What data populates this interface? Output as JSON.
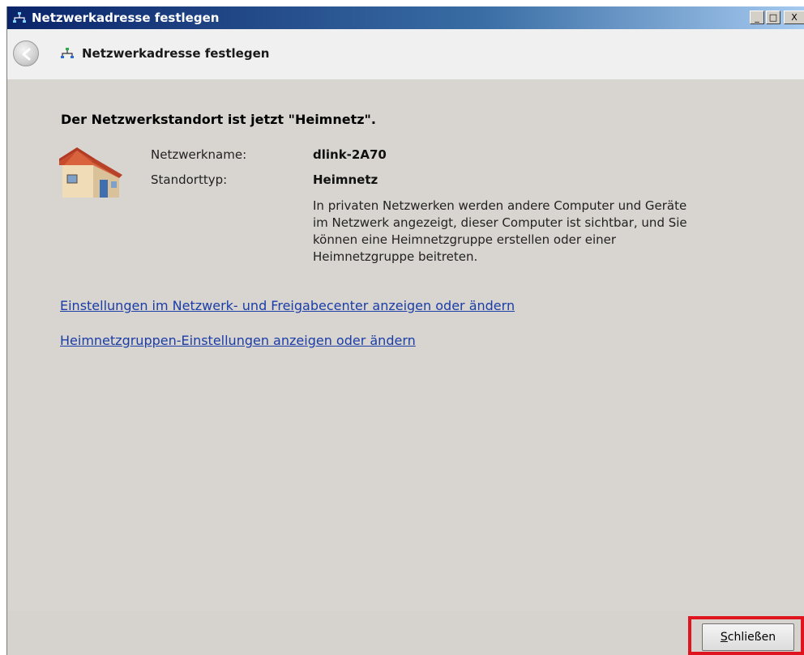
{
  "window": {
    "title": "Netzwerkadresse festlegen",
    "controls": {
      "minimize": "_",
      "maximize": "□",
      "close": "X"
    }
  },
  "nav": {
    "title": "Netzwerkadresse festlegen",
    "back_icon": "back-arrow-icon",
    "network_icon": "network-icon"
  },
  "content": {
    "heading": "Der Netzwerkstandort ist jetzt \"Heimnetz\".",
    "icon": "house-icon",
    "rows": [
      {
        "label": "Netzwerkname:",
        "value": "dlink-2A70"
      },
      {
        "label": "Standorttyp:",
        "value": "Heimnetz"
      }
    ],
    "description": "In privaten Netzwerken werden andere Computer und Geräte im Netzwerk angezeigt, dieser Computer ist sichtbar, und Sie können eine Heimnetzgruppe erstellen oder einer Heimnetzgruppe beitreten.",
    "links": [
      "Einstellungen im Netzwerk- und Freigabecenter anzeigen oder ändern",
      "Heimnetzgruppen-Einstellungen anzeigen oder ändern"
    ]
  },
  "footer": {
    "close_mnemonic": "S",
    "close_rest": "chließen"
  },
  "colors": {
    "highlight": "#e0141e",
    "link": "#1a3da8",
    "titlebar_start": "#0a246a"
  }
}
